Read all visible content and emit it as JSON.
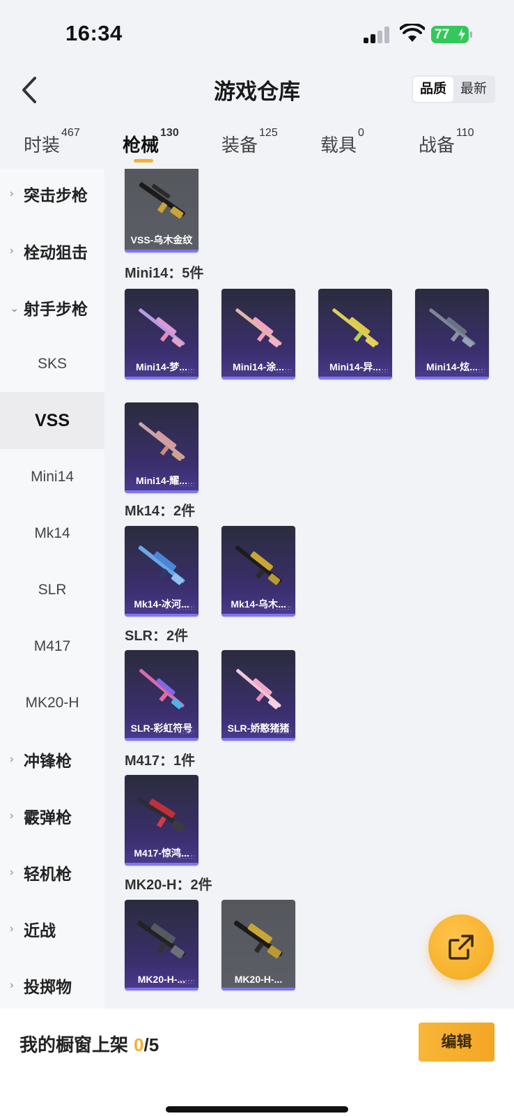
{
  "status": {
    "time": "16:34",
    "battery": "77"
  },
  "header": {
    "title": "游戏仓库",
    "sort_quality": "品质",
    "sort_latest": "最新"
  },
  "tabs": [
    {
      "label": "时装",
      "count": "467"
    },
    {
      "label": "枪械",
      "count": "130"
    },
    {
      "label": "装备",
      "count": "125"
    },
    {
      "label": "载具",
      "count": "0"
    },
    {
      "label": "战备",
      "count": "110"
    }
  ],
  "sidebar": {
    "groups": [
      "突击步枪",
      "栓动狙击",
      "射手步枪",
      "冲锋枪",
      "霰弹枪",
      "轻机枪",
      "近战",
      "投掷物"
    ],
    "subitems": [
      "SKS",
      "VSS",
      "Mini14",
      "Mk14",
      "SLR",
      "M417",
      "MK20-H"
    ]
  },
  "sections": {
    "vss_card": "VSS-乌木金纹",
    "mini14_title": "Mini14：5件",
    "mini14_cards": [
      "Mini14-梦...",
      "Mini14-涂...",
      "Mini14-异...",
      "Mini14-炫...",
      "Mini14-耀..."
    ],
    "mk14_title": "Mk14：2件",
    "mk14_cards": [
      "Mk14-冰河...",
      "Mk14-乌木..."
    ],
    "slr_title": "SLR：2件",
    "slr_cards": [
      "SLR-彩虹符号",
      "SLR-娇憨猪猪"
    ],
    "m417_title": "M417：1件",
    "m417_cards": [
      "M417-惊鸿..."
    ],
    "mk20_title": "MK20-H：2件",
    "mk20_cards": [
      "MK20-H-...",
      "MK20-H-..."
    ]
  },
  "bottom": {
    "showcase_label": "我的橱窗上架",
    "current": "0",
    "total": "/5",
    "edit": "编辑"
  },
  "icons": {
    "back": "chevron-left-icon",
    "share": "external-link-icon"
  },
  "colors": {
    "accent": "#f4b132",
    "card_purple": "#3b2f6e",
    "card_cap": "#7f76f0"
  }
}
